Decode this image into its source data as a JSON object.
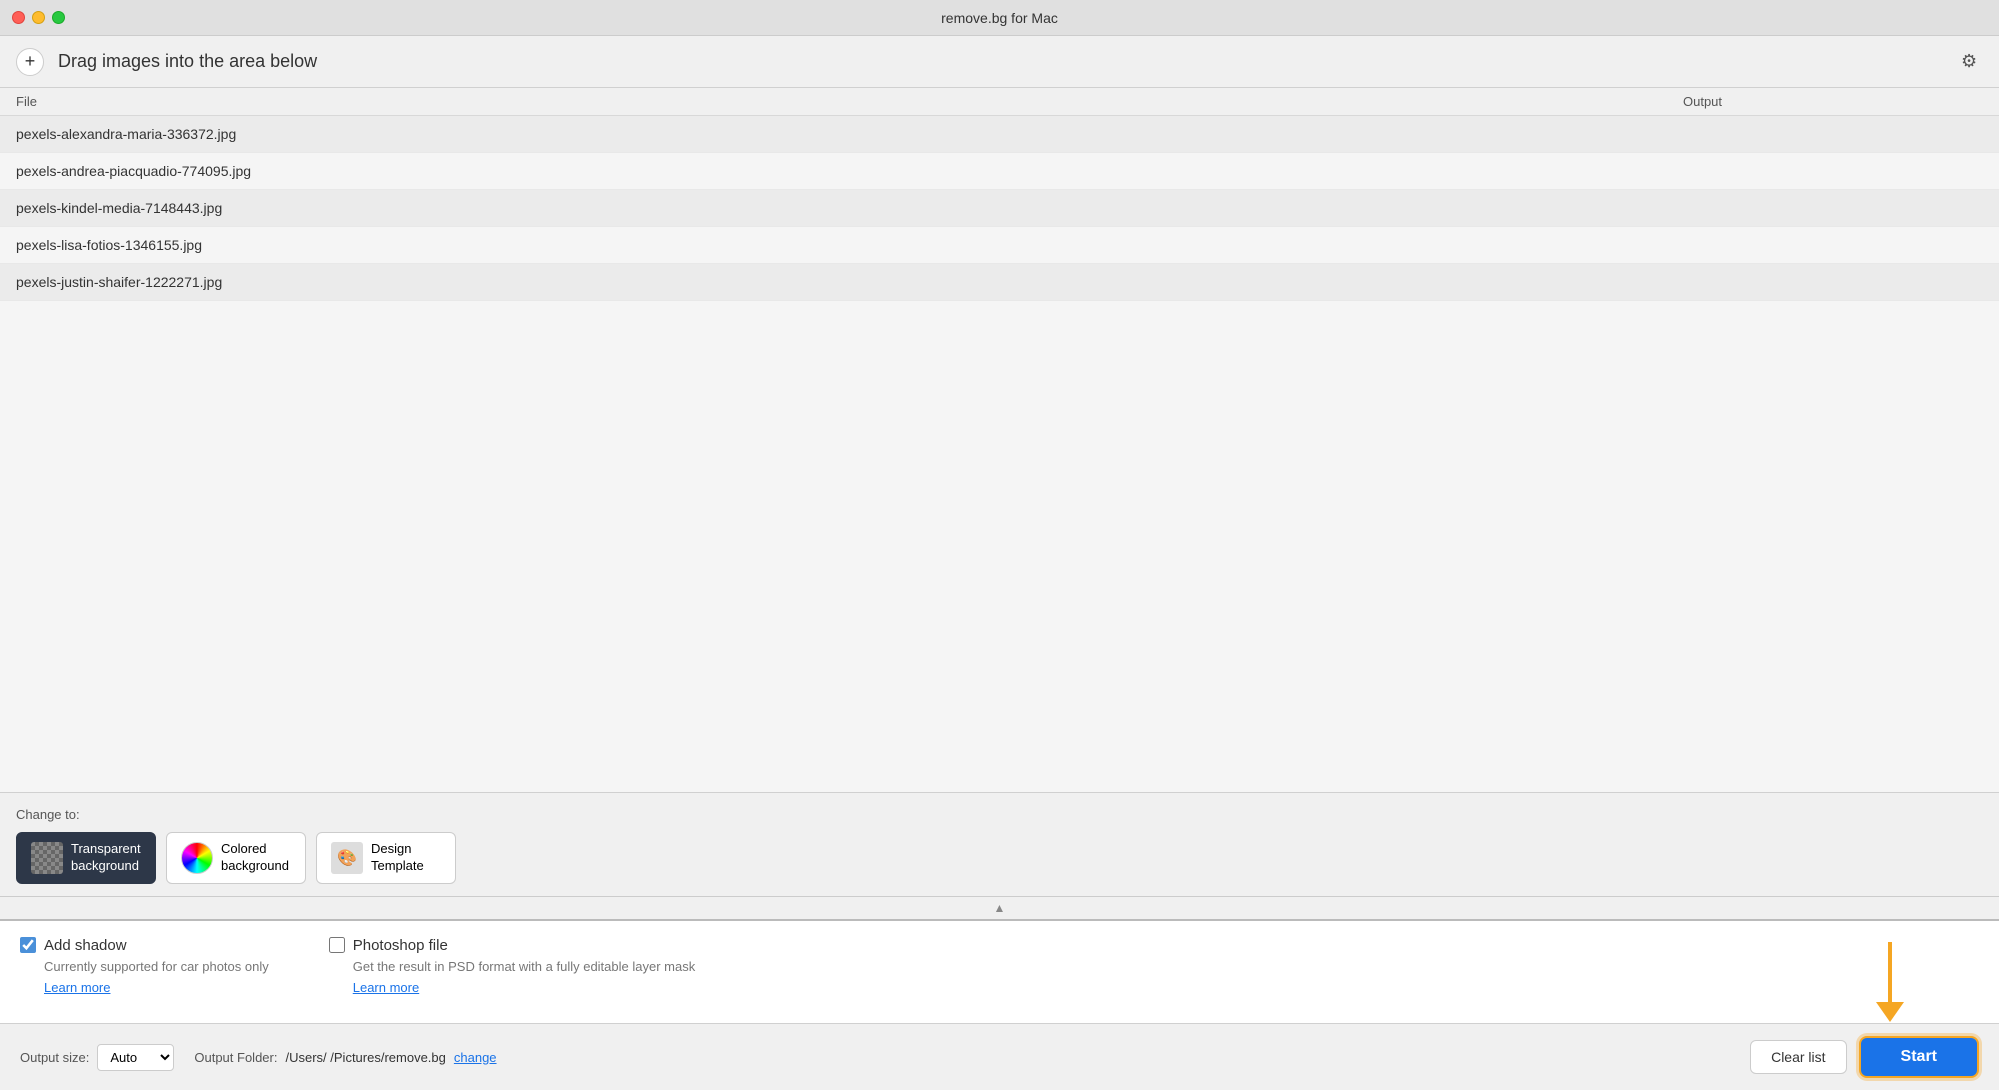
{
  "titlebar": {
    "title": "remove.bg for Mac"
  },
  "toolbar": {
    "add_button_label": "+",
    "drag_hint": "Drag images into the area below",
    "settings_icon": "⚙"
  },
  "table": {
    "col_file": "File",
    "col_output": "Output",
    "rows": [
      {
        "filename": "pexels-alexandra-maria-336372.jpg"
      },
      {
        "filename": "pexels-andrea-piacquadio-774095.jpg"
      },
      {
        "filename": "pexels-kindel-media-7148443.jpg"
      },
      {
        "filename": "pexels-lisa-fotios-1346155.jpg"
      },
      {
        "filename": "pexels-justin-shaifer-1222271.jpg"
      }
    ]
  },
  "change_to": {
    "label": "Change to:",
    "options": [
      {
        "id": "transparent",
        "label": "Transparent\nbackground",
        "active": true
      },
      {
        "id": "colored",
        "label": "Colored\nbackground",
        "active": false
      },
      {
        "id": "design",
        "label": "Design\nTemplate",
        "active": false
      }
    ]
  },
  "options": {
    "add_shadow": {
      "title": "Add shadow",
      "desc": "Currently supported for car photos only",
      "link": "Learn more",
      "checked": true
    },
    "photoshop_file": {
      "title": "Photoshop file",
      "desc": "Get the result in PSD format with a fully editable layer mask",
      "link": "Learn more",
      "checked": false
    }
  },
  "footer": {
    "output_size_label": "Output size:",
    "output_size_value": "Auto",
    "output_folder_label": "Output Folder:",
    "folder_path": "/Users/  /Pictures/remove.bg",
    "folder_change": "change",
    "clear_btn": "Clear list",
    "start_btn": "Start"
  }
}
